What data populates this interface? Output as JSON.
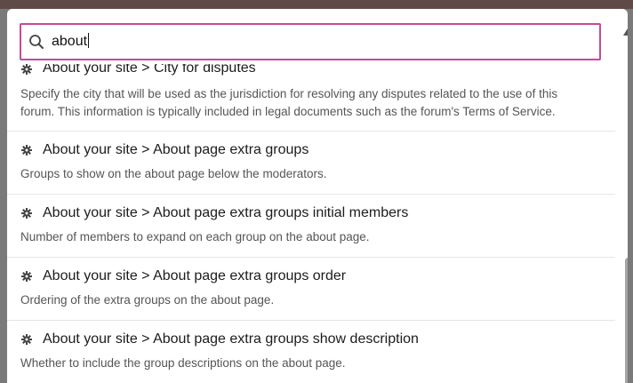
{
  "search": {
    "value": "about"
  },
  "results": [
    {
      "title": "About your site > City for disputes",
      "description": "Specify the city that will be used as the jurisdiction for resolving any disputes related to the use of this forum. This information is typically included in legal documents such as the forum's Terms of Service."
    },
    {
      "title": "About your site > About page extra groups",
      "description": "Groups to show on the about page below the moderators."
    },
    {
      "title": "About your site > About page extra groups initial members",
      "description": "Number of members to expand on each group on the about page."
    },
    {
      "title": "About your site > About page extra groups order",
      "description": "Ordering of the extra groups on the about page."
    },
    {
      "title": "About your site > About page extra groups show description",
      "description": "Whether to include the group descriptions on the about page."
    }
  ],
  "colors": {
    "search_border": "#c44a9a",
    "title": "#1c1c1c",
    "description": "#555555"
  },
  "icons": {
    "search": "search-icon",
    "result": "gear-icon"
  }
}
